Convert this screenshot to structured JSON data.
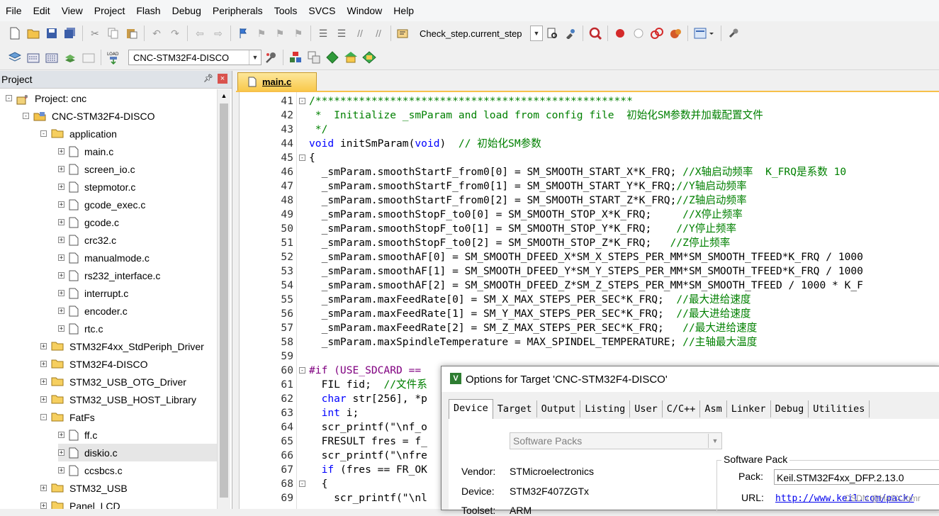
{
  "menubar": [
    "File",
    "Edit",
    "View",
    "Project",
    "Flash",
    "Debug",
    "Peripherals",
    "Tools",
    "SVCS",
    "Window",
    "Help"
  ],
  "toolbar1": {
    "find_combo": "Check_step.current_step"
  },
  "toolbar2": {
    "target_combo": "CNC-STM32F4-DISCO"
  },
  "project_panel": {
    "title": "Project",
    "tree": [
      {
        "label": "Project: cnc",
        "level": 0,
        "kind": "root",
        "exp": "-"
      },
      {
        "label": "CNC-STM32F4-DISCO",
        "level": 1,
        "kind": "target",
        "exp": "-"
      },
      {
        "label": "application",
        "level": 2,
        "kind": "folder-open",
        "exp": "-"
      },
      {
        "label": "main.c",
        "level": 3,
        "kind": "file",
        "exp": "+"
      },
      {
        "label": "screen_io.c",
        "level": 3,
        "kind": "file",
        "exp": "+"
      },
      {
        "label": "stepmotor.c",
        "level": 3,
        "kind": "file",
        "exp": "+"
      },
      {
        "label": "gcode_exec.c",
        "level": 3,
        "kind": "file",
        "exp": "+"
      },
      {
        "label": "gcode.c",
        "level": 3,
        "kind": "file",
        "exp": "+"
      },
      {
        "label": "crc32.c",
        "level": 3,
        "kind": "file",
        "exp": "+"
      },
      {
        "label": "manualmode.c",
        "level": 3,
        "kind": "file",
        "exp": "+"
      },
      {
        "label": "rs232_interface.c",
        "level": 3,
        "kind": "file",
        "exp": "+"
      },
      {
        "label": "interrupt.c",
        "level": 3,
        "kind": "file",
        "exp": "+"
      },
      {
        "label": "encoder.c",
        "level": 3,
        "kind": "file",
        "exp": "+"
      },
      {
        "label": "rtc.c",
        "level": 3,
        "kind": "file",
        "exp": "+"
      },
      {
        "label": "STM32F4xx_StdPeriph_Driver",
        "level": 2,
        "kind": "folder",
        "exp": "+"
      },
      {
        "label": "STM32F4-DISCO",
        "level": 2,
        "kind": "folder",
        "exp": "+"
      },
      {
        "label": "STM32_USB_OTG_Driver",
        "level": 2,
        "kind": "folder",
        "exp": "+"
      },
      {
        "label": "STM32_USB_HOST_Library",
        "level": 2,
        "kind": "folder",
        "exp": "+"
      },
      {
        "label": "FatFs",
        "level": 2,
        "kind": "folder-open",
        "exp": "-"
      },
      {
        "label": "ff.c",
        "level": 3,
        "kind": "file",
        "exp": "+"
      },
      {
        "label": "diskio.c",
        "level": 3,
        "kind": "file",
        "exp": "+",
        "selected": true
      },
      {
        "label": "ccsbcs.c",
        "level": 3,
        "kind": "file",
        "exp": "+"
      },
      {
        "label": "STM32_USB",
        "level": 2,
        "kind": "folder",
        "exp": "+"
      },
      {
        "label": "Panel_LCD",
        "level": 2,
        "kind": "folder",
        "exp": "+"
      }
    ]
  },
  "editor": {
    "tab": "main.c",
    "lines": [
      {
        "n": "41",
        "fold": "-",
        "text": "/***************************************************",
        "cls": "c-cmt"
      },
      {
        "n": "42",
        "fold": "",
        "text": " *  Initialize _smParam and load from config file  初始化SM参数并加载配置文件",
        "cls": "c-cmt"
      },
      {
        "n": "43",
        "fold": "",
        "text": " */",
        "cls": "c-cmt"
      },
      {
        "n": "44",
        "fold": "",
        "text": "void initSmParam(void)  // 初始化SM参数",
        "cls": "mixed44"
      },
      {
        "n": "45",
        "fold": "-",
        "text": "{",
        "cls": ""
      },
      {
        "n": "46",
        "fold": "",
        "text": "  _smParam.smoothStartF_from0[0] = SM_SMOOTH_START_X*K_FRQ; //X轴启动频率  K_FRQ是系数 10",
        "cls": "mixed"
      },
      {
        "n": "47",
        "fold": "",
        "text": "  _smParam.smoothStartF_from0[1] = SM_SMOOTH_START_Y*K_FRQ;//Y轴启动频率",
        "cls": "mixed"
      },
      {
        "n": "48",
        "fold": "",
        "text": "  _smParam.smoothStartF_from0[2] = SM_SMOOTH_START_Z*K_FRQ;//Z轴启动频率",
        "cls": "mixed"
      },
      {
        "n": "49",
        "fold": "",
        "text": "  _smParam.smoothStopF_to0[0] = SM_SMOOTH_STOP_X*K_FRQ;     //X停止频率",
        "cls": "mixed"
      },
      {
        "n": "50",
        "fold": "",
        "text": "  _smParam.smoothStopF_to0[1] = SM_SMOOTH_STOP_Y*K_FRQ;    //Y停止频率",
        "cls": "mixed"
      },
      {
        "n": "51",
        "fold": "",
        "text": "  _smParam.smoothStopF_to0[2] = SM_SMOOTH_STOP_Z*K_FRQ;   //Z停止频率",
        "cls": "mixed"
      },
      {
        "n": "52",
        "fold": "",
        "text": "  _smParam.smoothAF[0] = SM_SMOOTH_DFEED_X*SM_X_STEPS_PER_MM*SM_SMOOTH_TFEED*K_FRQ / 1000",
        "cls": ""
      },
      {
        "n": "53",
        "fold": "",
        "text": "  _smParam.smoothAF[1] = SM_SMOOTH_DFEED_Y*SM_Y_STEPS_PER_MM*SM_SMOOTH_TFEED*K_FRQ / 1000",
        "cls": ""
      },
      {
        "n": "54",
        "fold": "",
        "text": "  _smParam.smoothAF[2] = SM_SMOOTH_DFEED_Z*SM_Z_STEPS_PER_MM*SM_SMOOTH_TFEED / 1000 * K_F",
        "cls": ""
      },
      {
        "n": "55",
        "fold": "",
        "text": "  _smParam.maxFeedRate[0] = SM_X_MAX_STEPS_PER_SEC*K_FRQ;  //最大进给速度",
        "cls": "mixed"
      },
      {
        "n": "56",
        "fold": "",
        "text": "  _smParam.maxFeedRate[1] = SM_Y_MAX_STEPS_PER_SEC*K_FRQ;  //最大进给速度",
        "cls": "mixed"
      },
      {
        "n": "57",
        "fold": "",
        "text": "  _smParam.maxFeedRate[2] = SM_Z_MAX_STEPS_PER_SEC*K_FRQ;   //最大进给速度",
        "cls": "mixed"
      },
      {
        "n": "58",
        "fold": "",
        "text": "  _smParam.maxSpindleTemperature = MAX_SPINDEL_TEMPERATURE; //主轴最大温度",
        "cls": "mixed"
      },
      {
        "n": "59",
        "fold": "",
        "text": "",
        "cls": ""
      },
      {
        "n": "60",
        "fold": "-",
        "text": "#if (USE_SDCARD == ",
        "cls": "c-pp"
      },
      {
        "n": "61",
        "fold": "",
        "text": "  FIL fid;  //文件系",
        "cls": "mixed"
      },
      {
        "n": "62",
        "fold": "",
        "text": "  char str[256], *p",
        "cls": "kwstart"
      },
      {
        "n": "63",
        "fold": "",
        "text": "  int i;",
        "cls": "kwstart"
      },
      {
        "n": "64",
        "fold": "",
        "text": "  scr_printf(\"\\nf_o",
        "cls": ""
      },
      {
        "n": "65",
        "fold": "",
        "text": "  FRESULT fres = f_",
        "cls": ""
      },
      {
        "n": "66",
        "fold": "",
        "text": "  scr_printf(\"\\nfre",
        "cls": ""
      },
      {
        "n": "67",
        "fold": "",
        "text": "  if (fres == FR_OK",
        "cls": "kwstart"
      },
      {
        "n": "68",
        "fold": "-",
        "text": "  {",
        "cls": ""
      },
      {
        "n": "69",
        "fold": "",
        "text": "    scr_printf(\"\\nl",
        "cls": ""
      }
    ]
  },
  "dialog": {
    "title": "Options for Target 'CNC-STM32F4-DISCO'",
    "tabs": [
      "Device",
      "Target",
      "Output",
      "Listing",
      "User",
      "C/C++",
      "Asm",
      "Linker",
      "Debug",
      "Utilities"
    ],
    "active_tab": "Device",
    "pack_combo": "Software Packs",
    "vendor_label": "Vendor:",
    "vendor_value": "STMicroelectronics",
    "device_label": "Device:",
    "device_value": "STM32F407ZGTx",
    "toolset_label": "Toolset:",
    "toolset_value": "ARM",
    "software_pack_group": "Software Pack",
    "pack_label": "Pack:",
    "pack_value": "Keil.STM32F4xx_DFP.2.13.0",
    "url_label": "URL:",
    "url_value": "http://www.keil.com/pack/"
  },
  "watermark": "CSDN @HaSXJqmr"
}
